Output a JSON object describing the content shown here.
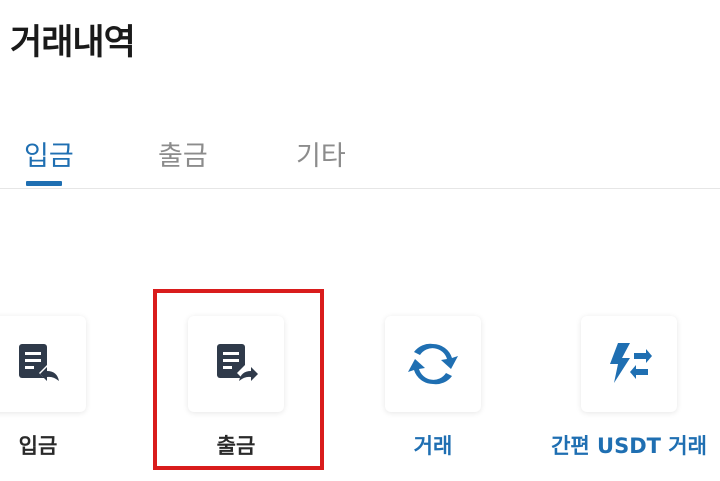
{
  "header": {
    "title": "거래내역"
  },
  "tabs": [
    {
      "label": "입금",
      "active": true
    },
    {
      "label": "출금",
      "active": false
    },
    {
      "label": "기타",
      "active": false
    }
  ],
  "actions": [
    {
      "label": "입금",
      "icon": "deposit-doc-icon"
    },
    {
      "label": "출금",
      "icon": "withdraw-doc-icon",
      "highlighted": true
    },
    {
      "label": "거래",
      "icon": "refresh-icon"
    },
    {
      "label": "간편 USDT 거래",
      "icon": "quick-swap-icon"
    }
  ],
  "colors": {
    "accent": "#1f6fb2",
    "icon_dark": "#2f3a4a",
    "highlight": "#d91c1c"
  }
}
